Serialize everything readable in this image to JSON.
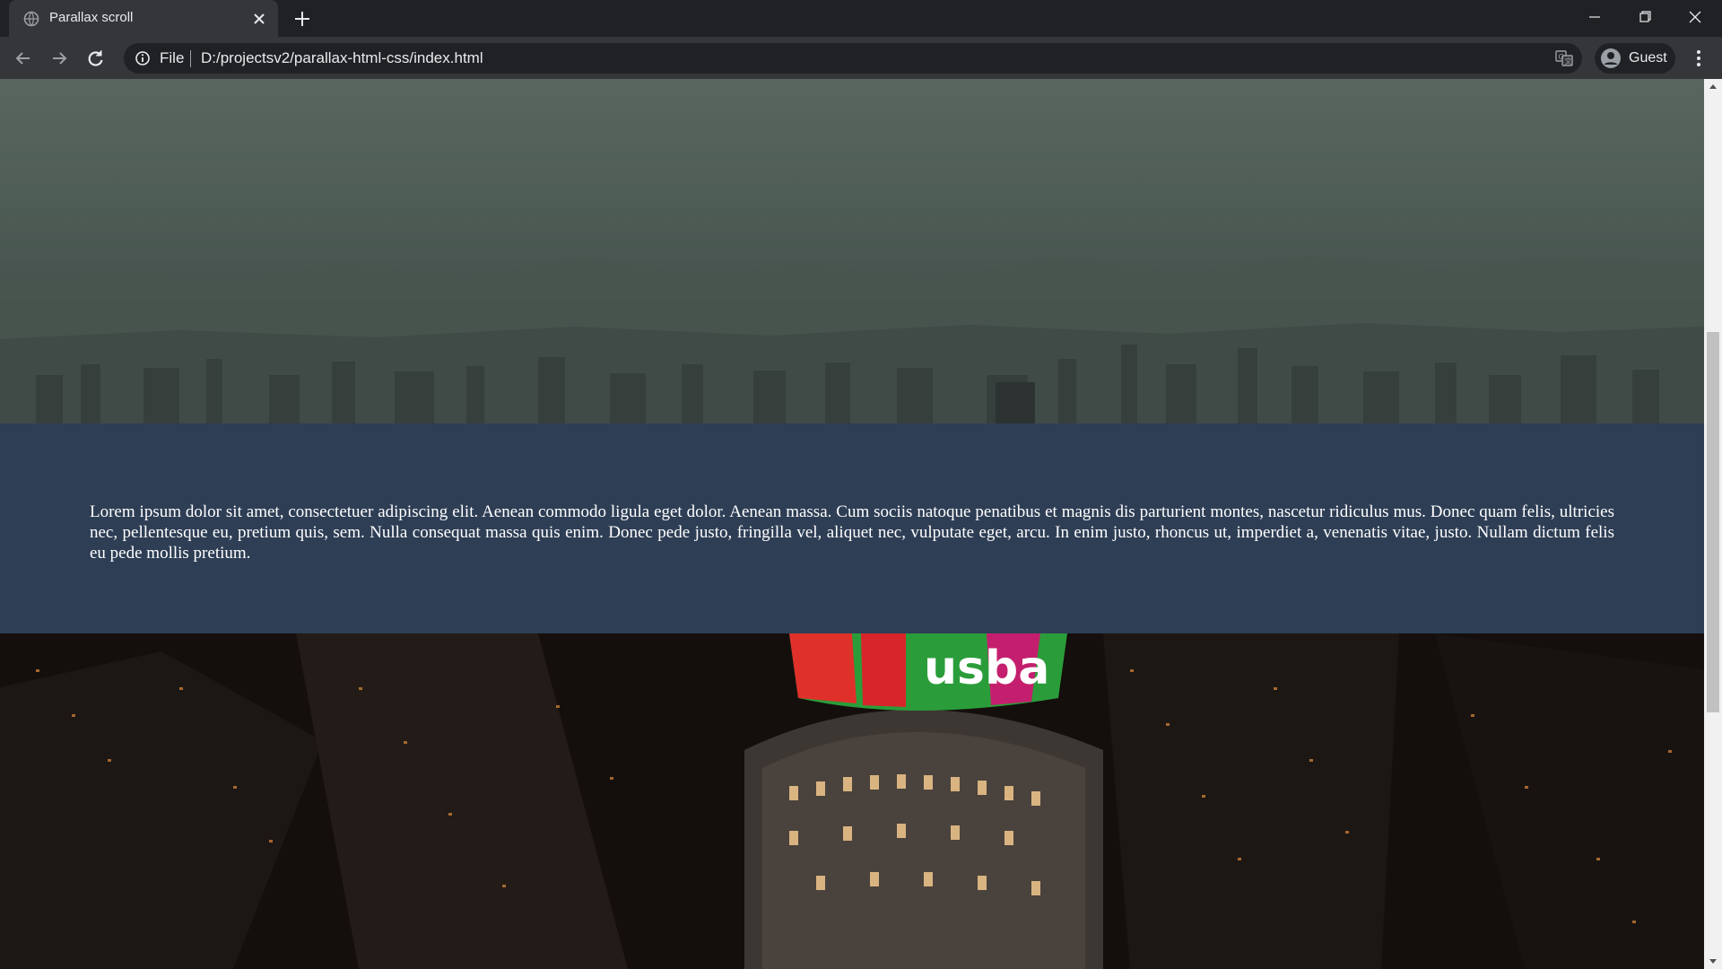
{
  "browser": {
    "tab": {
      "title": "Parallax scroll",
      "favicon": "globe-icon"
    },
    "new_tab_icon": "plus-icon",
    "window_controls": [
      "minimize-icon",
      "restore-icon",
      "close-icon"
    ],
    "omnibox": {
      "scheme": "File",
      "url": "D:/projectsv2/parallax-html-css/index.html",
      "info_icon": "info-icon",
      "translate_icon": "translate-icon"
    },
    "profile": {
      "label": "Guest",
      "icon": "avatar-icon"
    },
    "nav_icons": [
      "back-arrow-icon",
      "forward-arrow-icon",
      "reload-icon"
    ],
    "menu_icon": "kebab-menu-icon"
  },
  "page": {
    "hero_top": {
      "description_color": "#4f5d57"
    },
    "content": {
      "background": "#2e3e55",
      "paragraph": "Lorem ipsum dolor sit amet, consectetuer adipiscing elit. Aenean commodo ligula eget dolor. Aenean massa. Cum sociis natoque penatibus et magnis dis parturient montes, nascetur ridiculus mus. Donec quam felis, ultricies nec, pellentesque eu, pretium quis, sem. Nulla consequat massa quis enim. Donec pede justo, fringilla vel, aliquet nec, vulputate eget, arcu. In enim justo, rhoncus ut, imperdiet a, venenatis vitae, justo. Nullam dictum felis eu pede mollis pretium."
    },
    "hero_bottom": {
      "sign_text": "usba"
    }
  },
  "scrollbar": {
    "position_fraction": 0.3
  }
}
